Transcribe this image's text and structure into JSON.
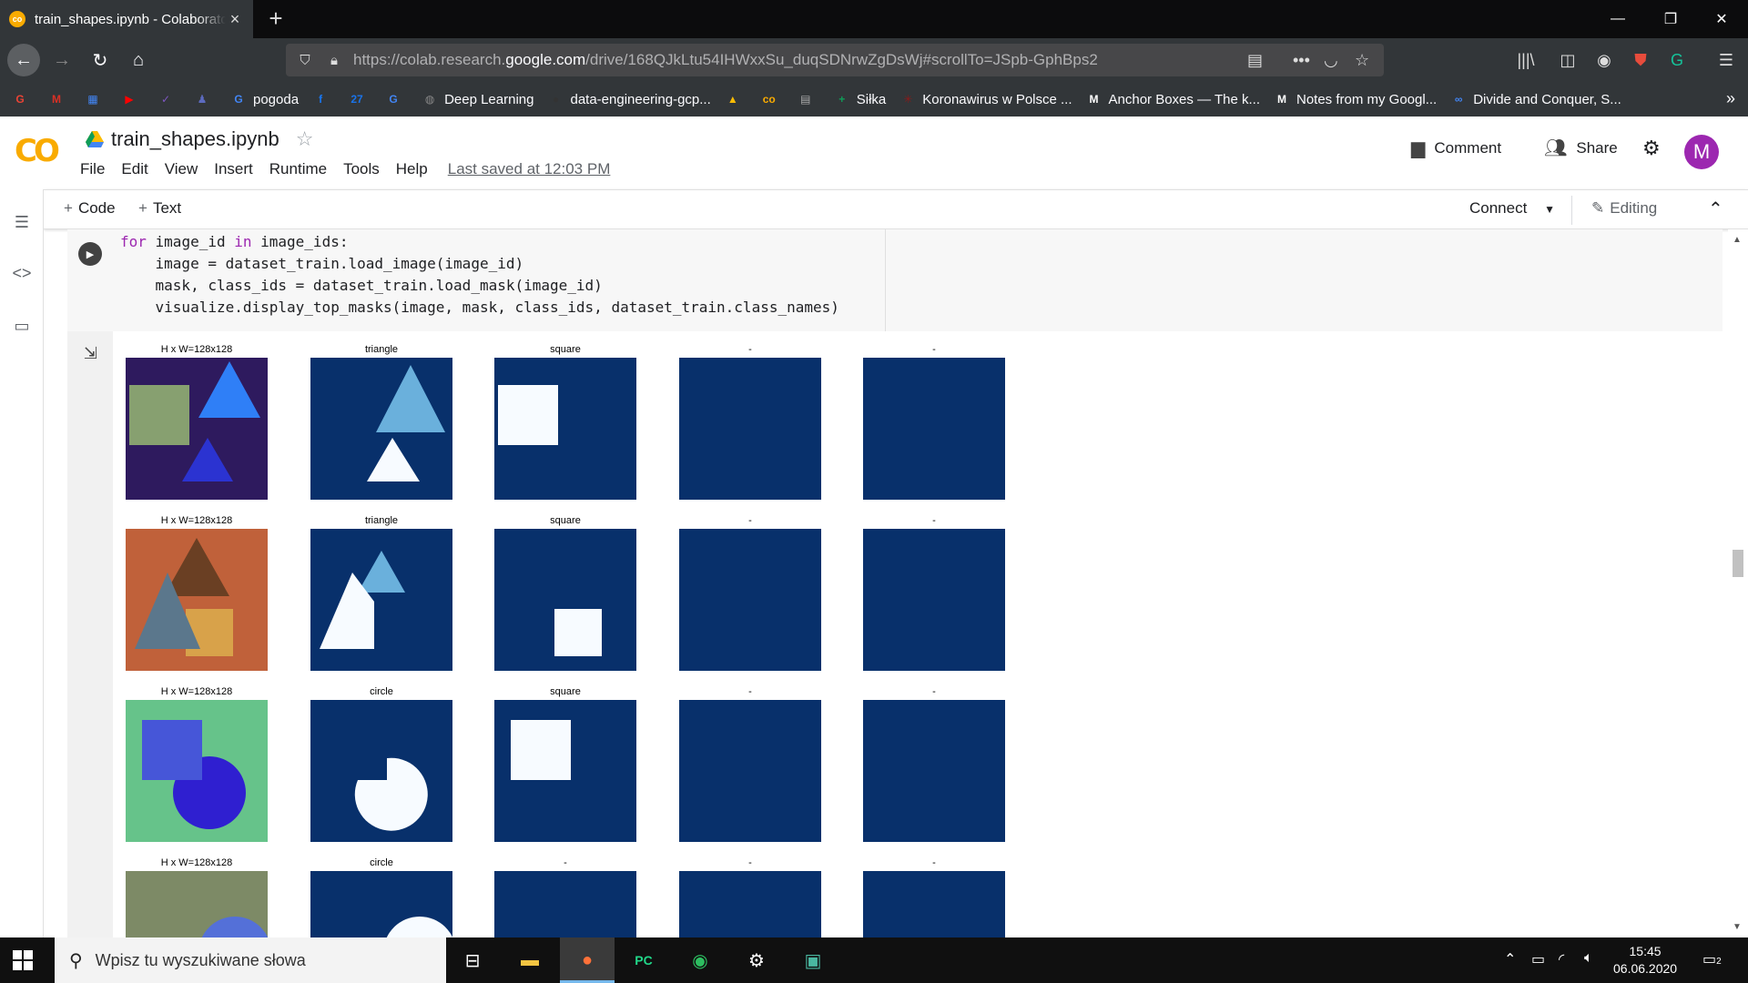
{
  "browser": {
    "tab_title": "train_shapes.ipynb - Colaboratory",
    "url_prefix": "https://colab.research.",
    "url_domain": "google.com",
    "url_rest": "/drive/168QJkLtu54IHWxxSu_duqSDNrwZgDsWj#scrollTo=JSpb-GphBps2",
    "bookmarks": [
      {
        "label": "",
        "icon": "google-icon",
        "color": "#ea4335",
        "glyph": "G"
      },
      {
        "label": "",
        "icon": "gmail-icon",
        "color": "#d93025",
        "glyph": "M"
      },
      {
        "label": "",
        "icon": "calendar-icon",
        "color": "#4285f4",
        "glyph": "▦"
      },
      {
        "label": "",
        "icon": "youtube-icon",
        "color": "#ff0000",
        "glyph": "▶"
      },
      {
        "label": "",
        "icon": "tasks-icon",
        "color": "#7e57c2",
        "glyph": "✓"
      },
      {
        "label": "",
        "icon": "person-icon",
        "color": "#5c6bc0",
        "glyph": "♟"
      },
      {
        "label": "pogoda",
        "icon": "google-icon",
        "color": "#4285f4",
        "glyph": "G"
      },
      {
        "label": "",
        "icon": "facebook-icon",
        "color": "#1877f2",
        "glyph": "f"
      },
      {
        "label": "",
        "icon": "calendar-27-icon",
        "color": "#1a73e8",
        "glyph": "27"
      },
      {
        "label": "",
        "icon": "translate-icon",
        "color": "#4285f4",
        "glyph": "G"
      },
      {
        "label": "Deep Learning",
        "icon": "globe-icon",
        "color": "#888888",
        "glyph": "◍"
      },
      {
        "label": "data-engineering-gcp...",
        "icon": "github-icon",
        "color": "#333333",
        "glyph": "●"
      },
      {
        "label": "",
        "icon": "drive-icon",
        "color": "#fbbc04",
        "glyph": "▲"
      },
      {
        "label": "",
        "icon": "colab-icon",
        "color": "#f9ab00",
        "glyph": "co"
      },
      {
        "label": "",
        "icon": "notes-icon",
        "color": "#aaaaaa",
        "glyph": "▤"
      },
      {
        "label": "Siłka",
        "icon": "sheets-icon",
        "color": "#0f9d58",
        "glyph": "+"
      },
      {
        "label": "Koronawirus w Polsce ...",
        "icon": "virus-icon",
        "color": "#8b1a1a",
        "glyph": "✳"
      },
      {
        "label": "Anchor Boxes — The k...",
        "icon": "medium-icon",
        "color": "#ffffff",
        "glyph": "M"
      },
      {
        "label": "Notes from my Googl...",
        "icon": "medium-icon",
        "color": "#ffffff",
        "glyph": "M"
      },
      {
        "label": "Divide and Conquer, S...",
        "icon": "colab-icon",
        "color": "#4285f4",
        "glyph": "∞"
      }
    ]
  },
  "colab": {
    "doc_title": "train_shapes.ipynb",
    "menu": [
      "File",
      "Edit",
      "View",
      "Insert",
      "Runtime",
      "Tools",
      "Help"
    ],
    "last_saved": "Last saved at 12:03 PM",
    "comment": "Comment",
    "share": "Share",
    "avatar_letter": "M",
    "toolbar": {
      "code": "Code",
      "text": "Text",
      "connect": "Connect",
      "editing": "Editing"
    }
  },
  "code_lines": [
    {
      "kw": "for",
      "rest1": " image_id ",
      "kw2": "in",
      "rest2": " image_ids:"
    },
    {
      "text": "    image = dataset_train.load_image(image_id)"
    },
    {
      "text": "    mask, class_ids = dataset_train.load_mask(image_id)"
    },
    {
      "text": "    visualize.display_top_masks(image, mask, class_ids, dataset_train.class_names)"
    }
  ],
  "output_rows": [
    {
      "labels": [
        "H x W=128x128",
        "triangle",
        "square",
        "-",
        "-"
      ]
    },
    {
      "labels": [
        "H x W=128x128",
        "triangle",
        "square",
        "-",
        "-"
      ]
    },
    {
      "labels": [
        "H x W=128x128",
        "circle",
        "square",
        "-",
        "-"
      ]
    },
    {
      "labels": [
        "H x W=128x128",
        "circle",
        "-",
        "-",
        "-"
      ]
    }
  ],
  "colors": {
    "mask_bg": "#08306b",
    "mask_fg": "#f7fbff",
    "accent": "#f9ab00"
  },
  "taskbar": {
    "search_placeholder": "Wpisz tu wyszukiwane słowa",
    "time": "15:45",
    "date": "06.06.2020",
    "notif_count": "2"
  }
}
